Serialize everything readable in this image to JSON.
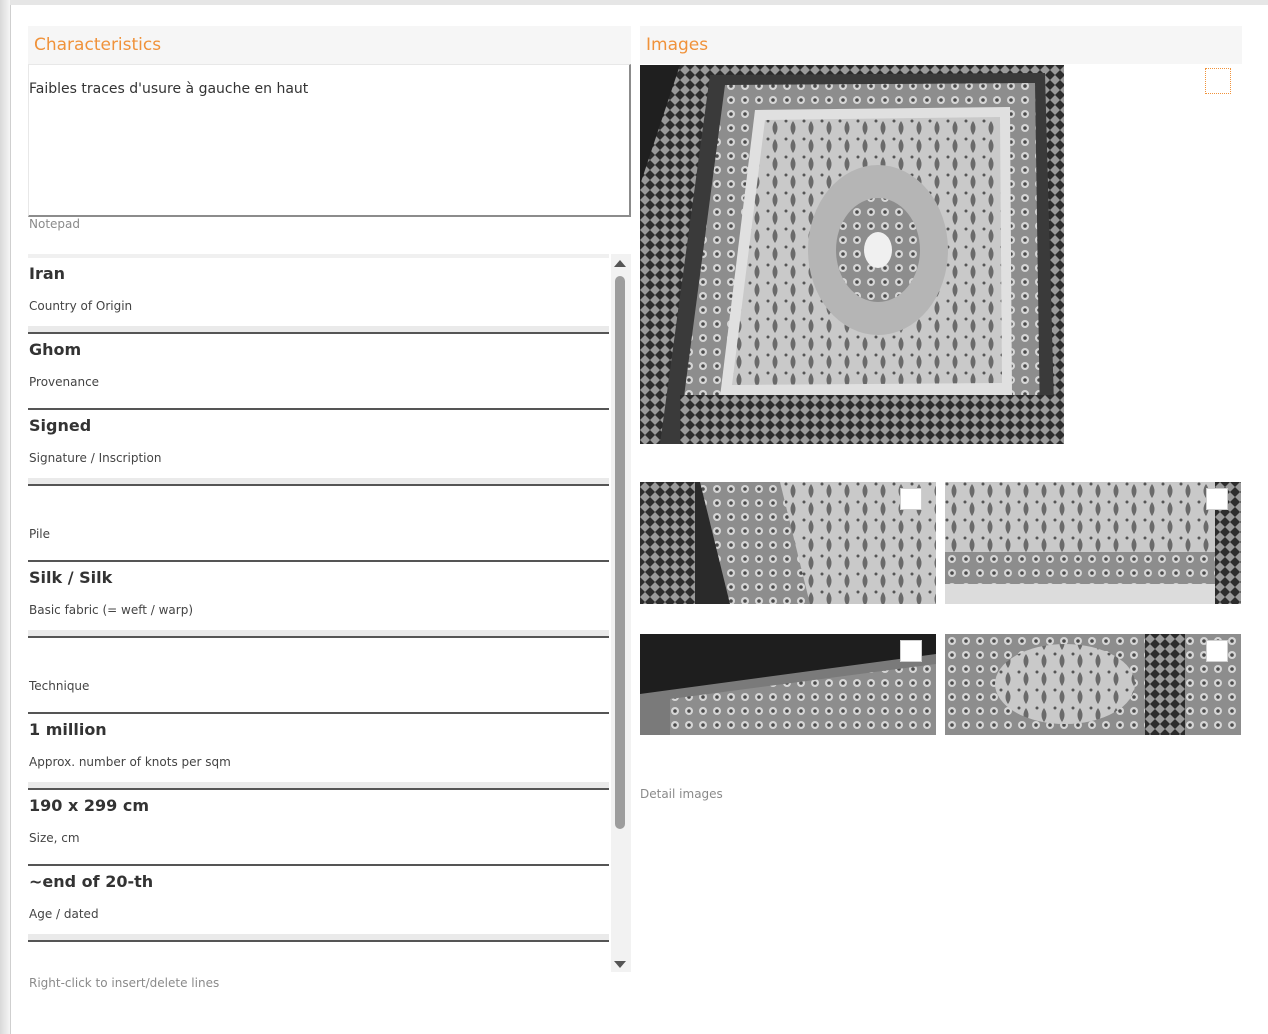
{
  "characteristics": {
    "title": "Characteristics",
    "notepad_text": "Faibles traces d'usure à gauche en haut",
    "notepad_caption": "Notepad",
    "rows": [
      {
        "value": "Iran",
        "label": "Country of Origin"
      },
      {
        "value": "Ghom",
        "label": "Provenance"
      },
      {
        "value": "Signed",
        "label": "Signature / Inscription"
      },
      {
        "value": "",
        "label": "Pile"
      },
      {
        "value": "Silk / Silk",
        "label": "Basic fabric (= weft / warp)"
      },
      {
        "value": "",
        "label": "Technique"
      },
      {
        "value": "1 million",
        "label": "Approx. number of knots per sqm"
      },
      {
        "value": "190 x 299 cm",
        "label": "Size, cm"
      },
      {
        "value": "~end of 20-th",
        "label": "Age / dated"
      }
    ],
    "footer_hint": "Right-click to insert/delete lines"
  },
  "images": {
    "title": "Images",
    "detail_caption": "Detail images"
  }
}
